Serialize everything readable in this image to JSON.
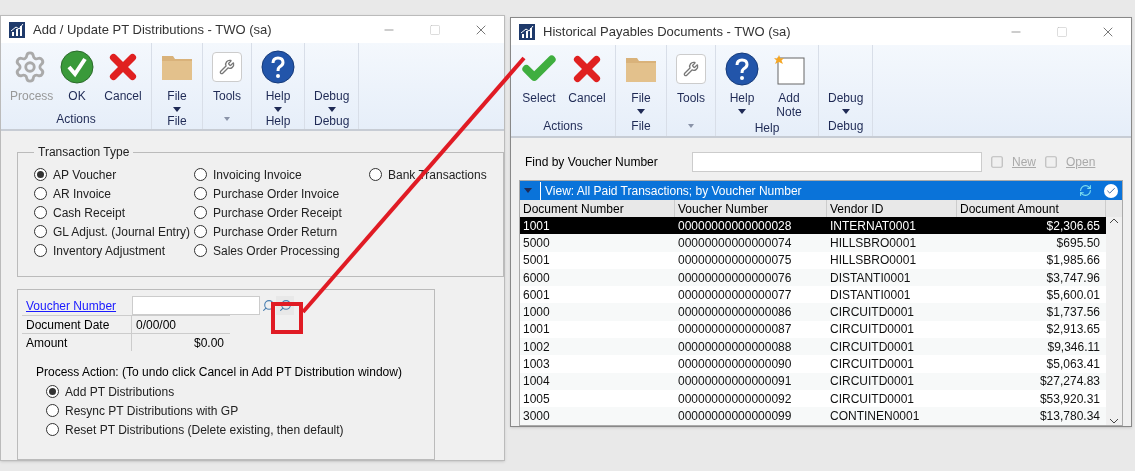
{
  "left_window": {
    "title": "Add /  Update PT Distributions  -  TWO (sa)",
    "ribbon": [
      {
        "label": "Actions",
        "buttons": [
          {
            "label": "Process",
            "kind": "gears",
            "disabled": true,
            "dropdown": false
          },
          {
            "label": "OK",
            "kind": "ok",
            "disabled": false,
            "dropdown": false
          },
          {
            "label": "Cancel",
            "kind": "cancel",
            "disabled": false,
            "dropdown": false
          }
        ]
      },
      {
        "label": "File",
        "buttons": [
          {
            "label": "File",
            "kind": "folder",
            "disabled": false,
            "dropdown": true
          }
        ]
      },
      {
        "buttons": [
          {
            "label": "Tools",
            "kind": "tools",
            "disabled": false,
            "dropdown": false
          }
        ]
      },
      {
        "label": "Help",
        "buttons": [
          {
            "label": "Help",
            "kind": "help",
            "disabled": false,
            "dropdown": true
          }
        ]
      },
      {
        "label": "Debug",
        "buttons": [
          {
            "label": "Debug",
            "kind": "plain",
            "disabled": false,
            "dropdown": true
          }
        ]
      }
    ],
    "transaction_type": {
      "title": "Transaction Type",
      "options": [
        {
          "label": "AP Voucher",
          "selected": true
        },
        {
          "label": "AR Invoice",
          "selected": false
        },
        {
          "label": "Cash Receipt",
          "selected": false
        },
        {
          "label": "GL Adjust. (Journal Entry)",
          "selected": false
        },
        {
          "label": "Inventory Adjustment",
          "selected": false
        },
        {
          "label": "Invoicing Invoice",
          "selected": false
        },
        {
          "label": "Purchase Order Invoice",
          "selected": false
        },
        {
          "label": "Purchase Order Receipt",
          "selected": false
        },
        {
          "label": "Purchase Order Return",
          "selected": false
        },
        {
          "label": "Sales Order Processing",
          "selected": false
        },
        {
          "label": "Bank Transactions",
          "selected": false
        }
      ]
    },
    "voucher_number": {
      "label": "Voucher Number"
    },
    "fields": [
      {
        "label": "Document Date",
        "value": "0/00/00"
      },
      {
        "label": "Amount",
        "value": "$0.00"
      }
    ],
    "process_action": {
      "label": "Process Action: (To undo click Cancel in Add PT Distribution window)",
      "options": [
        {
          "label": "Add PT Distributions",
          "selected": true
        },
        {
          "label": "Resync PT Distributions with GP",
          "selected": false
        },
        {
          "label": "Reset PT Distributions (Delete existing, then default)",
          "selected": false
        }
      ]
    }
  },
  "right_window": {
    "title": "Historical Payables Documents  -  TWO (sa)",
    "ribbon": [
      {
        "label": "Actions",
        "buttons": [
          {
            "label": "Select",
            "kind": "select",
            "disabled": false,
            "dropdown": false
          },
          {
            "label": "Cancel",
            "kind": "cancel",
            "disabled": false,
            "dropdown": false
          }
        ]
      },
      {
        "label": "File",
        "buttons": [
          {
            "label": "File",
            "kind": "folder",
            "disabled": false,
            "dropdown": true
          }
        ]
      },
      {
        "buttons": [
          {
            "label": "Tools",
            "kind": "tools",
            "disabled": false,
            "dropdown": false
          }
        ]
      },
      {
        "label": "Help",
        "buttons": [
          {
            "label": "Help",
            "kind": "help",
            "disabled": false,
            "dropdown": true
          },
          {
            "label": "Add Note",
            "kind": "note",
            "disabled": false,
            "dropdown": false
          }
        ]
      },
      {
        "label": "Debug",
        "buttons": [
          {
            "label": "Debug",
            "kind": "plain",
            "disabled": false,
            "dropdown": true
          }
        ]
      }
    ],
    "find": {
      "label": "Find by Voucher Number"
    },
    "actions": [
      {
        "label": "New",
        "disabled": true
      },
      {
        "label": "Open",
        "disabled": true
      }
    ],
    "view": {
      "label": "View: All Paid Transactions; by Voucher Number"
    },
    "table": {
      "columns": [
        "Document Number",
        "Voucher Number",
        "Vendor ID",
        "Document Amount"
      ],
      "rows": [
        {
          "cells": [
            "1001",
            "00000000000000028",
            "INTERNAT0001",
            "$2,306.65"
          ],
          "selected": true
        },
        {
          "cells": [
            "5000",
            "00000000000000074",
            "HILLSBRO0001",
            "$695.50"
          ],
          "selected": false
        },
        {
          "cells": [
            "5001",
            "00000000000000075",
            "HILLSBRO0001",
            "$1,985.66"
          ],
          "selected": false
        },
        {
          "cells": [
            "6000",
            "00000000000000076",
            "DISTANTI0001",
            "$3,747.96"
          ],
          "selected": false
        },
        {
          "cells": [
            "6001",
            "00000000000000077",
            "DISTANTI0001",
            "$5,600.01"
          ],
          "selected": false
        },
        {
          "cells": [
            "1000",
            "00000000000000086",
            "CIRCUITD0001",
            "$1,737.56"
          ],
          "selected": false
        },
        {
          "cells": [
            "1001",
            "00000000000000087",
            "CIRCUITD0001",
            "$2,913.65"
          ],
          "selected": false
        },
        {
          "cells": [
            "1002",
            "00000000000000088",
            "CIRCUITD0001",
            "$9,346.11"
          ],
          "selected": false
        },
        {
          "cells": [
            "1003",
            "00000000000000090",
            "CIRCUITD0001",
            "$5,063.41"
          ],
          "selected": false
        },
        {
          "cells": [
            "1004",
            "00000000000000091",
            "CIRCUITD0001",
            "$27,274.83"
          ],
          "selected": false
        },
        {
          "cells": [
            "1005",
            "00000000000000092",
            "CIRCUITD0001",
            "$53,920.31"
          ],
          "selected": false
        },
        {
          "cells": [
            "3000",
            "00000000000000099",
            "CONTINEN0001",
            "$13,780.34"
          ],
          "selected": false
        }
      ]
    }
  }
}
